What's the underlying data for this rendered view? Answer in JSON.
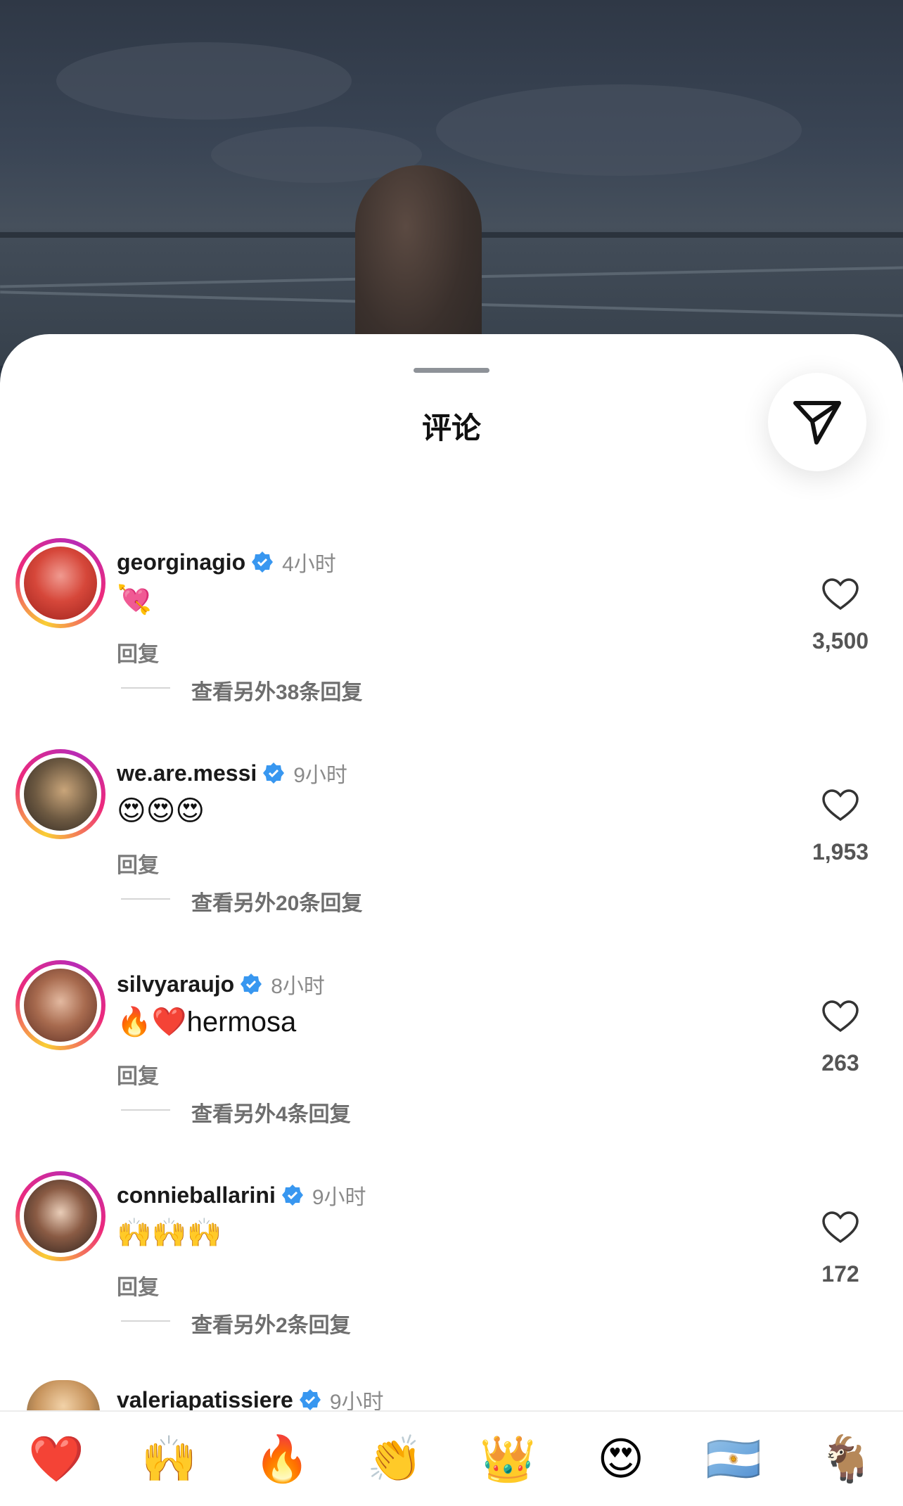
{
  "sheet": {
    "title": "评论"
  },
  "comments": [
    {
      "username": "georginagio",
      "time": "4小时",
      "text": "💘",
      "reply": "回复",
      "more": "查看另外38条回复",
      "likes": "3,500"
    },
    {
      "username": "we.are.messi",
      "time": "9小时",
      "text": "😍😍😍",
      "reply": "回复",
      "more": "查看另外20条回复",
      "likes": "1,953"
    },
    {
      "username": "silvyaraujo",
      "time": "8小时",
      "text": "🔥❤️hermosa",
      "reply": "回复",
      "more": "查看另外4条回复",
      "likes": "263"
    },
    {
      "username": "connieballarini",
      "time": "9小时",
      "text": "🙌🙌🙌",
      "reply": "回复",
      "more": "查看另外2条回复",
      "likes": "172"
    }
  ],
  "partial_comment": {
    "username": "valeriapatissiere",
    "time": "9小时"
  },
  "emoji_bar": [
    "❤️",
    "🙌",
    "🔥",
    "👏",
    "👑",
    "😍",
    "🇦🇷",
    "🐐"
  ],
  "colors": {
    "verified": "#3897f0",
    "accent_ring": "#ee2a7b"
  },
  "icons": {
    "share": "send-icon",
    "like": "heart-outline-icon",
    "verified": "verified-badge-icon"
  }
}
